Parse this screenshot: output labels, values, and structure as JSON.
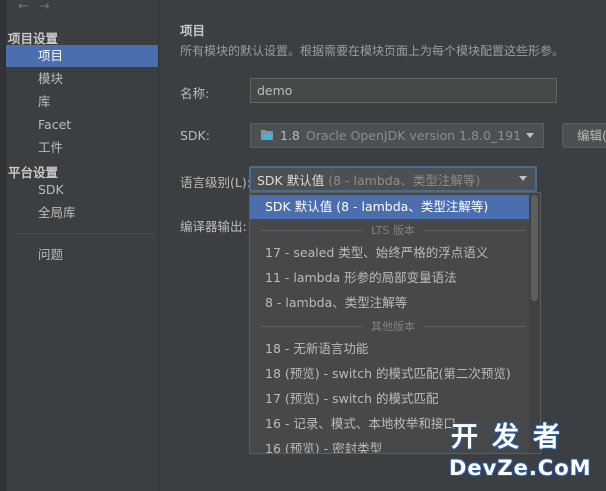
{
  "nav": {
    "back_icon": "arrow-left-icon",
    "forward_icon": "arrow-right-icon"
  },
  "sidebar": {
    "project_settings_header": "项目设置",
    "project_items": [
      {
        "label": "项目",
        "selected": true
      },
      {
        "label": "模块"
      },
      {
        "label": "库"
      },
      {
        "label": "Facet"
      },
      {
        "label": "工件"
      }
    ],
    "platform_settings_header": "平台设置",
    "platform_items": [
      {
        "label": "SDK"
      },
      {
        "label": "全局库"
      }
    ],
    "problems_label": "问题"
  },
  "main": {
    "title": "项目",
    "description": "所有模块的默认设置。根据需要在模块页面上为每个模块配置这些形参。",
    "name_label": "名称:",
    "name_value": "demo",
    "sdk_label": "SDK:",
    "sdk_icon": "jdk-folder-icon",
    "sdk_name": "1.8",
    "sdk_detail": "Oracle OpenJDK version 1.8.0_191",
    "edit_button_label": "编辑(",
    "language_level_label": "语言级别(L):",
    "language_level_value_main": "SDK 默认值",
    "language_level_value_detail": "(8 - lambda、类型注解等)",
    "compiler_output_label": "编译器输出:"
  },
  "dropdown": {
    "selected_item": "SDK 默认值 (8 - lambda、类型注解等)",
    "lts_separator": "LTS 版本",
    "lts_items": [
      "17 - sealed 类型、始终严格的浮点语义",
      "11 - lambda 形参的局部变量语法",
      "8 - lambda、类型注解等"
    ],
    "other_separator": "其他版本",
    "other_items": [
      "18 - 无新语言功能",
      "18 (预览) - switch 的模式匹配(第二次预览)",
      "17 (预览) - switch 的模式匹配",
      "16 - 记录、模式、本地枚举和接口",
      "16 (预览) - 密封类型"
    ]
  },
  "watermark": {
    "line1": "开发者",
    "line2": "DevZe.CoM"
  },
  "colors": {
    "accent": "#4b6eaf",
    "background": "#3c3f41",
    "focus_border": "#466d94"
  }
}
